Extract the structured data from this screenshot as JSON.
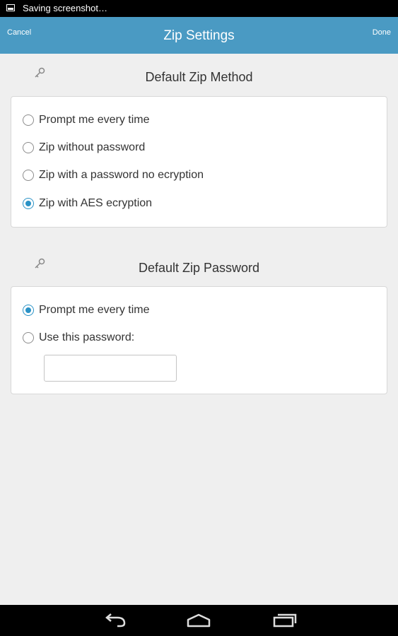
{
  "status_bar": {
    "text": "Saving screenshot…",
    "icon": "screenshot-icon"
  },
  "action_bar": {
    "cancel_label": "Cancel",
    "title": "Zip Settings",
    "done_label": "Done",
    "color": "#4a9ac3"
  },
  "sections": {
    "method": {
      "title": "Default Zip Method",
      "icon": "key-icon",
      "options": [
        {
          "label": "Prompt me every time",
          "checked": false
        },
        {
          "label": "Zip without password",
          "checked": false
        },
        {
          "label": "Zip with a password no ecryption",
          "checked": false
        },
        {
          "label": "Zip with AES ecryption",
          "checked": true
        }
      ]
    },
    "password": {
      "title": "Default Zip Password",
      "icon": "key-icon",
      "options": [
        {
          "label": "Prompt me every time",
          "checked": true
        },
        {
          "label": "Use this password:",
          "checked": false
        }
      ],
      "input_value": ""
    }
  },
  "nav_bar": {
    "buttons": [
      "back-icon",
      "home-icon",
      "recent-apps-icon"
    ]
  },
  "colors": {
    "accent": "#2a92c6",
    "background": "#efefef"
  }
}
